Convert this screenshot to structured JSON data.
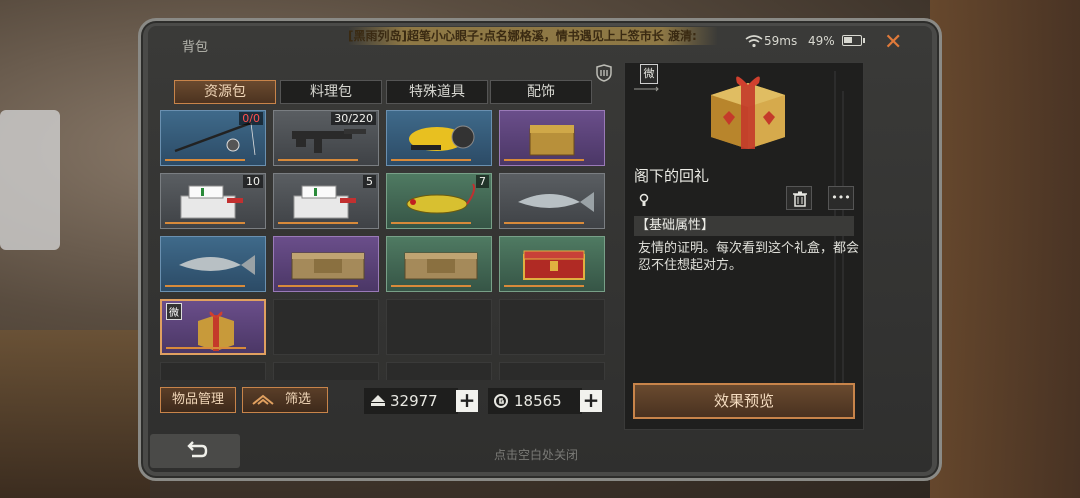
{
  "window": {
    "title": "背包",
    "marquee": "[黑雨列岛]超笔小心眼子:点名娜格溪，情书遇见上上签市长 渡清:",
    "ping": "59ms",
    "battery": "49%",
    "battery_level": 0.49,
    "close_icon": "close-icon"
  },
  "tabs": [
    {
      "label": "资源包",
      "active": true
    },
    {
      "label": "料理包",
      "active": false
    },
    {
      "label": "特殊道具",
      "active": false
    },
    {
      "label": "配饰",
      "active": false
    }
  ],
  "grid": {
    "slots": [
      {
        "item": "fishing-rod",
        "count": "0/0",
        "count_red": true,
        "rarity": "blue"
      },
      {
        "item": "rifle",
        "count": "30/220",
        "rarity": "gray"
      },
      {
        "item": "underwater-scooter",
        "count": "",
        "rarity": "blue"
      },
      {
        "item": "treasure-chest",
        "count": "",
        "rarity": "purple"
      },
      {
        "item": "medical-kit",
        "count": "10",
        "rarity": "gray"
      },
      {
        "item": "medical-kit",
        "count": "5",
        "rarity": "gray"
      },
      {
        "item": "fishing-lure",
        "count": "7",
        "rarity": "green"
      },
      {
        "item": "fish",
        "count": "",
        "rarity": "gray"
      },
      {
        "item": "fish",
        "count": "",
        "rarity": "blue"
      },
      {
        "item": "supply-crate",
        "count": "",
        "rarity": "purple"
      },
      {
        "item": "supply-crate",
        "count": "",
        "rarity": "green"
      },
      {
        "item": "red-chest",
        "count": "",
        "rarity": "green"
      },
      {
        "item": "gift-box",
        "count": "",
        "rarity": "purple",
        "selected": true,
        "badge": "微"
      },
      {
        "item": "",
        "count": "",
        "rarity": "empty"
      },
      {
        "item": "",
        "count": "",
        "rarity": "empty"
      },
      {
        "item": "",
        "count": "",
        "rarity": "empty"
      },
      {
        "item": "",
        "count": "",
        "rarity": "empty"
      },
      {
        "item": "",
        "count": "",
        "rarity": "empty"
      },
      {
        "item": "",
        "count": "",
        "rarity": "empty"
      },
      {
        "item": "",
        "count": "",
        "rarity": "empty"
      }
    ]
  },
  "controls": {
    "manage_label": "物品管理",
    "filter_label": "筛选",
    "currency1": "32977",
    "currency2": "18565",
    "plus": "+"
  },
  "detail": {
    "badge": "微",
    "item_name": "阁下的回礼",
    "attr_header": "【基础属性】",
    "description": "友情的证明。每次看到这个礼盒，都会忍不住想起对方。",
    "preview_label": "效果预览",
    "more": "•••"
  },
  "footer": {
    "hint": "点击空白处关闭"
  },
  "colors": {
    "accent": "#c8844a",
    "close": "#e07a3a",
    "count_red": "#ff5050"
  }
}
